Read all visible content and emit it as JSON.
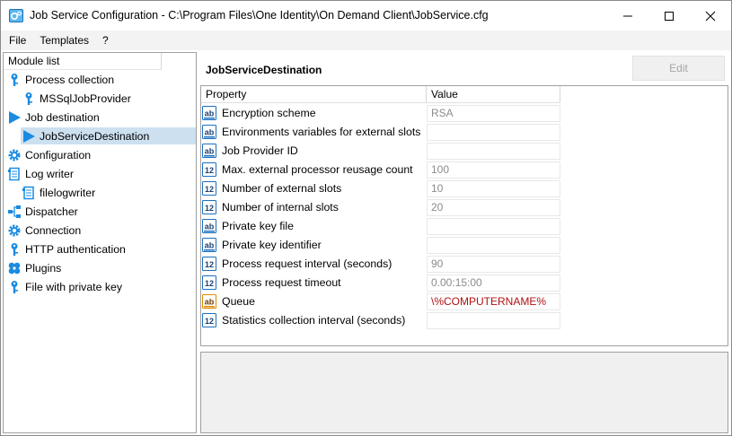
{
  "window": {
    "title": "Job Service Configuration - C:\\Program Files\\One Identity\\On Demand Client\\JobService.cfg",
    "minimize_icon": "minimize-icon",
    "maximize_icon": "maximize-icon",
    "close_icon": "close-icon"
  },
  "menu": {
    "items": [
      "File",
      "Templates",
      "?"
    ]
  },
  "module_list": {
    "header": "Module list",
    "items": [
      {
        "label": "Process collection",
        "icon": "key-icon"
      },
      {
        "label": "MSSqlJobProvider",
        "icon": "key-icon"
      },
      {
        "label": "Job destination",
        "icon": "play-arrow-icon"
      },
      {
        "label": "JobServiceDestination",
        "icon": "play-arrow-icon",
        "selected": true
      },
      {
        "label": "Configuration",
        "icon": "gear-icon"
      },
      {
        "label": "Log writer",
        "icon": "log-icon"
      },
      {
        "label": "filelogwriter",
        "icon": "log-icon"
      },
      {
        "label": "Dispatcher",
        "icon": "network-icon"
      },
      {
        "label": "Connection",
        "icon": "gear-icon"
      },
      {
        "label": "HTTP authentication",
        "icon": "key-icon"
      },
      {
        "label": "Plugins",
        "icon": "puzzle-icon"
      },
      {
        "label": "File with private key",
        "icon": "key-icon"
      }
    ]
  },
  "detail": {
    "title": "JobServiceDestination",
    "edit_label": "Edit",
    "columns": {
      "property": "Property",
      "value": "Value"
    },
    "rows": [
      {
        "name": "Encryption scheme",
        "type": "ab",
        "value": "RSA"
      },
      {
        "name": "Environments variables for external slots",
        "type": "ab",
        "value": ""
      },
      {
        "name": "Job Provider ID",
        "type": "ab",
        "value": ""
      },
      {
        "name": "Max. external processor reusage count",
        "type": "12",
        "value": "100"
      },
      {
        "name": "Number of external slots",
        "type": "12",
        "value": "10"
      },
      {
        "name": "Number of internal slots",
        "type": "12",
        "value": "20"
      },
      {
        "name": "Private key file",
        "type": "ab",
        "value": ""
      },
      {
        "name": "Private key identifier",
        "type": "ab",
        "value": ""
      },
      {
        "name": "Process request interval (seconds)",
        "type": "12",
        "value": "90"
      },
      {
        "name": "Process request timeout",
        "type": "12",
        "value": "0.00:15:00"
      },
      {
        "name": "Queue",
        "type": "ab-orange",
        "value": "\\%COMPUTERNAME%"
      },
      {
        "name": "Statistics collection interval (seconds)",
        "type": "12",
        "value": ""
      }
    ]
  },
  "colors": {
    "accent": "#0a7fd4",
    "selected_row": "#cde0f0",
    "queue_value": "#b01010",
    "queue_icon": "#e08a00"
  }
}
